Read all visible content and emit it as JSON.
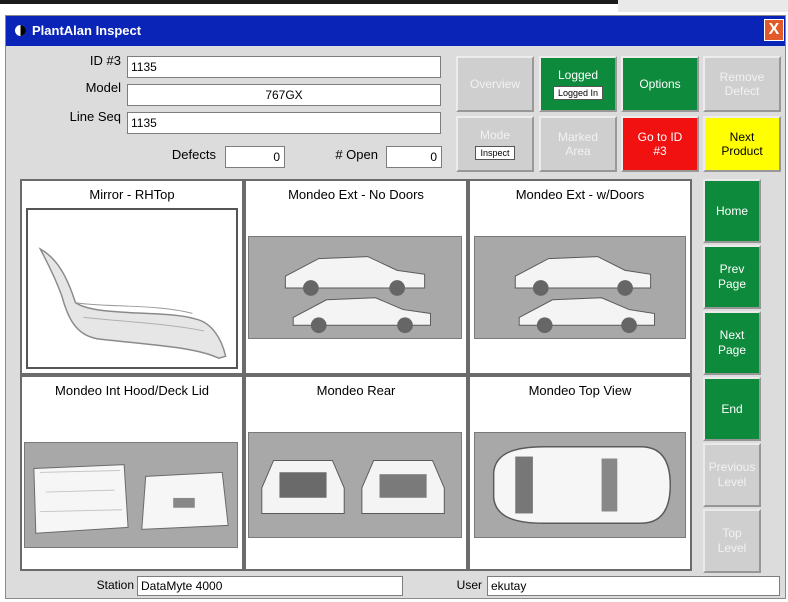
{
  "window": {
    "title": "PlantAlan Inspect",
    "close_label": "X"
  },
  "form": {
    "id_label": "ID #3",
    "id_value": "1135",
    "model_label": "Model",
    "model_value": "767GX",
    "line_seq_label": "Line Seq",
    "line_seq_value": "1135",
    "defects_label": "Defects",
    "defects_value": "0",
    "open_label": "# Open",
    "open_value": "0"
  },
  "buttons": {
    "overview": "Overview",
    "logged": "Logged",
    "logged_sub": "Logged In",
    "options": "Options",
    "remove_defect_1": "Remove",
    "remove_defect_2": "Defect",
    "mode": "Mode",
    "mode_sub": "Inspect",
    "marked_area_1": "Marked",
    "marked_area_2": "Area",
    "goto_id_1": "Go to ID",
    "goto_id_2": "#3",
    "next_product_1": "Next",
    "next_product_2": "Product"
  },
  "tiles": [
    {
      "title": "Mirror - RHTop"
    },
    {
      "title": "Mondeo Ext - No Doors"
    },
    {
      "title": "Mondeo Ext - w/Doors"
    },
    {
      "title": "Mondeo Int Hood/Deck Lid"
    },
    {
      "title": "Mondeo Rear"
    },
    {
      "title": "Mondeo Top View"
    }
  ],
  "sidebar": {
    "home": "Home",
    "prev_page_1": "Prev",
    "prev_page_2": "Page",
    "next_page_1": "Next",
    "next_page_2": "Page",
    "end": "End",
    "previous_level_1": "Previous",
    "previous_level_2": "Level",
    "top_level_1": "Top",
    "top_level_2": "Level"
  },
  "status": {
    "station_label": "Station",
    "station_value": "DataMyte 4000",
    "user_label": "User",
    "user_value": "ekutay"
  },
  "colors": {
    "titlebar": "#0a24b8",
    "green": "#0e8a3c",
    "red": "#f21111",
    "yellow": "#ffff00",
    "disabled": "#cfcfcf"
  }
}
